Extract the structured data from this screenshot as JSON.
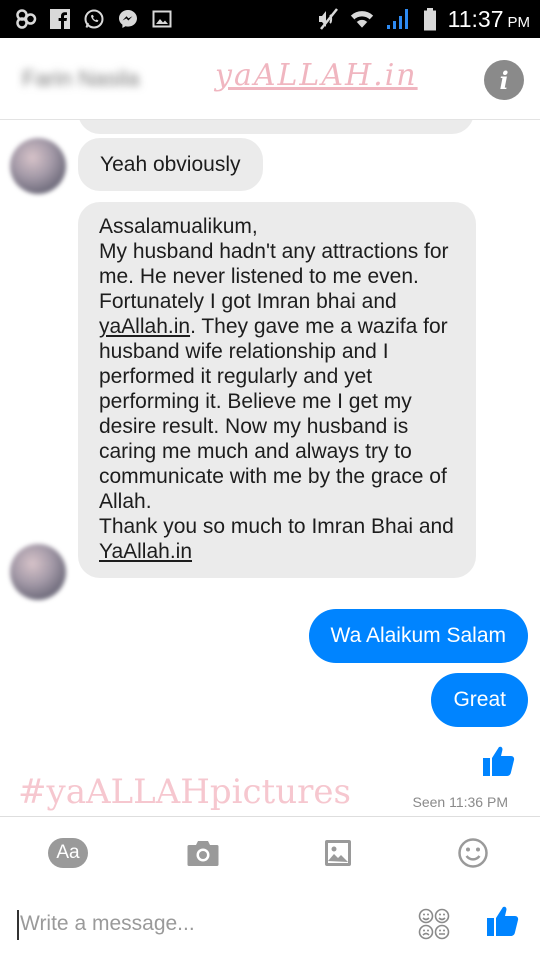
{
  "status_bar": {
    "time": "11:37",
    "ampm": "PM",
    "icons": [
      "link-icon",
      "facebook-icon",
      "whatsapp-icon",
      "messenger-icon",
      "gallery-icon",
      "mute-icon",
      "wifi-icon",
      "signal-icon",
      "battery-icon"
    ]
  },
  "header": {
    "contact_name": "Farin Nasila",
    "watermark": "yaALLAH.in",
    "info_icon": "info-icon",
    "info_label": "i"
  },
  "messages": {
    "yeah": "Yeah obviously",
    "long": {
      "part1": "Assalamualikum,\nMy husband hadn't any attractions for me. He never listened to me even. Fortunately I got Imran bhai and ",
      "link1": "yaAllah.in",
      "part2": ". They gave me a wazifa for husband wife relationship and I performed it regularly and yet performing it. Believe me I get my desire result. Now my husband is caring me much and always try to communicate with me by the grace of Allah.\nThank you so much to Imran Bhai and ",
      "link2": "YaAllah.in"
    },
    "sent1": "Wa Alaikum Salam",
    "sent2": "Great"
  },
  "footer": {
    "watermark": "#yaALLAHpictures",
    "seen": "Seen 11:36 PM"
  },
  "toolbar": {
    "aa_label": "Aa",
    "icons": [
      "text-style-icon",
      "camera-icon",
      "image-icon",
      "emoji-icon"
    ]
  },
  "composer": {
    "placeholder": "Write a message...",
    "icons": [
      "stickers-icon",
      "like-icon"
    ]
  },
  "colors": {
    "accent": "#0084ff",
    "incoming_bubble": "#ebebeb",
    "watermark": "#f0b6c0"
  }
}
